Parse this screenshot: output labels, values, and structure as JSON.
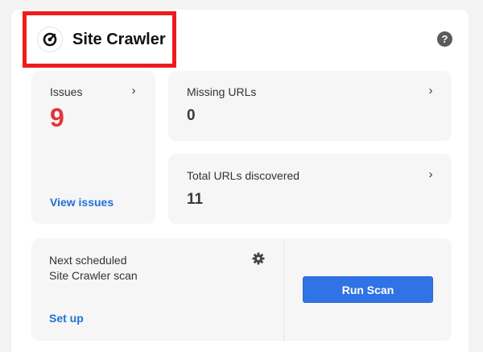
{
  "header": {
    "title": "Site Crawler",
    "help_glyph": "?"
  },
  "icons": {
    "logo": "crawler-logo-icon",
    "help": "question-circle-icon",
    "chevron": "chevron-right-icon",
    "gear": "gear-icon"
  },
  "colors": {
    "highlight_border": "#ee1c1c",
    "issues_value": "#e5343a",
    "link": "#1f6fd8",
    "button": "#2f73e6"
  },
  "issues": {
    "label": "Issues",
    "value": "9",
    "link": "View issues"
  },
  "missing_urls": {
    "label": "Missing URLs",
    "value": "0"
  },
  "total_urls": {
    "label": "Total URLs discovered",
    "value": "11"
  },
  "schedule": {
    "line1": "Next scheduled",
    "line2": "Site Crawler scan",
    "link": "Set up",
    "button": "Run Scan"
  }
}
